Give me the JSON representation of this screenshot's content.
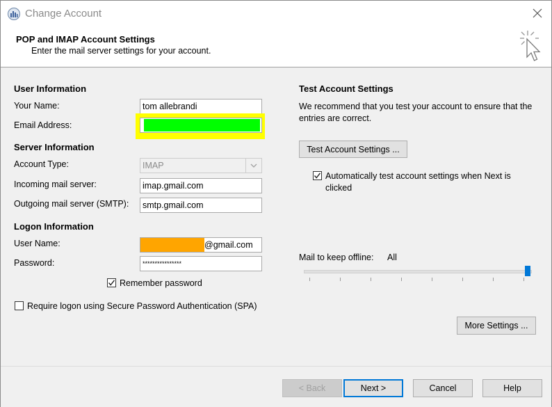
{
  "window": {
    "title": "Change Account"
  },
  "header": {
    "title": "POP and IMAP Account Settings",
    "subtitle": "Enter the mail server settings for your account."
  },
  "user_info": {
    "heading": "User Information",
    "name_label": "Your Name:",
    "name_value": "tom allebrandi",
    "email_label": "Email Address:",
    "email_redaction_color": "#00ff00",
    "email_highlight_color": "#ffff00"
  },
  "server_info": {
    "heading": "Server Information",
    "account_type_label": "Account Type:",
    "account_type_value": "IMAP",
    "incoming_label": "Incoming mail server:",
    "incoming_value": "imap.gmail.com",
    "outgoing_label": "Outgoing mail server (SMTP):",
    "outgoing_value": "smtp.gmail.com"
  },
  "logon_info": {
    "heading": "Logon Information",
    "username_label": "User Name:",
    "username_suffix": "@gmail.com",
    "username_redaction_color": "#ffa500",
    "password_label": "Password:",
    "password_value": "****************",
    "remember_label": "Remember password",
    "remember_checked": true,
    "spa_label": "Require logon using Secure Password Authentication (SPA)",
    "spa_checked": false
  },
  "test_settings": {
    "heading": "Test Account Settings",
    "description": "We recommend that you test your account to ensure that the entries are correct.",
    "button_label": "Test Account Settings ...",
    "auto_test_label": "Automatically test account settings when Next is clicked",
    "auto_test_checked": true
  },
  "offline": {
    "label": "Mail to keep offline:",
    "value": "All",
    "slider_position": 1.0,
    "accent_color": "#0078d7"
  },
  "more_settings_label": "More Settings ...",
  "footer": {
    "back_label": "< Back",
    "next_label": "Next >",
    "cancel_label": "Cancel",
    "help_label": "Help"
  }
}
